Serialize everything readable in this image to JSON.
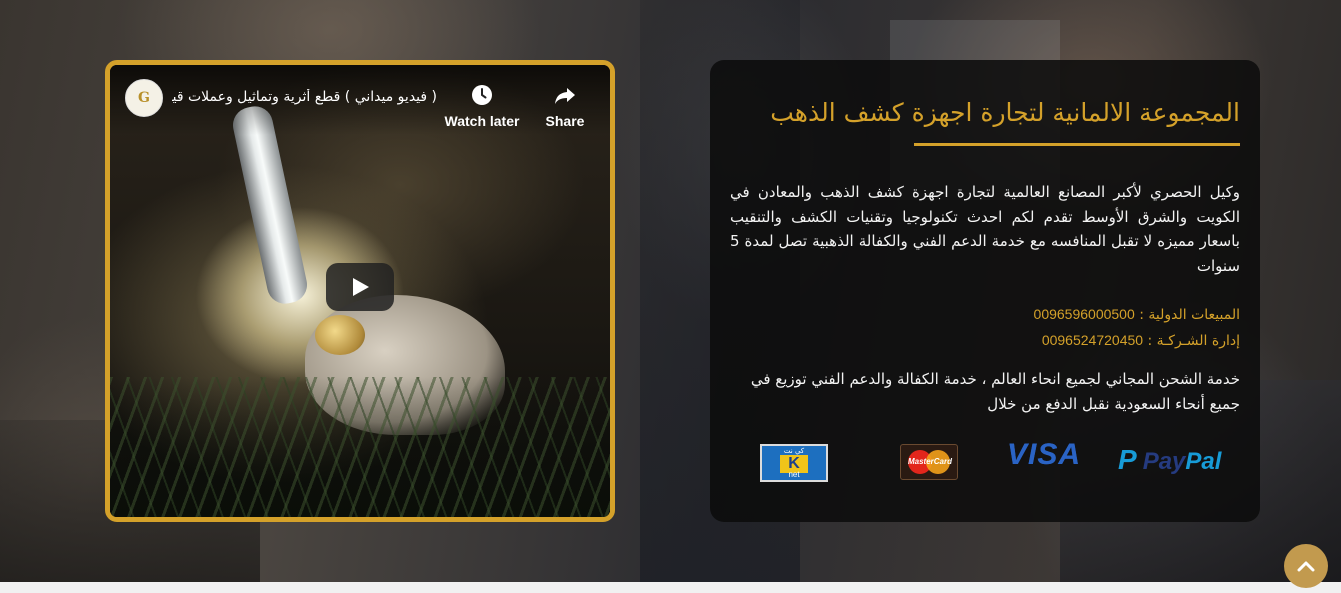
{
  "video": {
    "channel_logo_text": "G",
    "title": "( فيديو ميداني ) قطع أثرية وتماثيل وعملات قيمة...",
    "watch_later_label": "Watch later",
    "share_label": "Share"
  },
  "panel": {
    "title": "المجموعة الالمانية لتجارة اجهزة كشف الذهب",
    "description": "وكيل الحصري لأكبر المصانع العالمية لتجارة اجهزة كشف الذهب والمعادن في الكويت والشرق الأوسط تقدم لكم احدث تكنولوجيا وتقنيات الكشف والتنقيب باسعار مميزه لا تقبل المنافسه مع خدمة الدعم الفني والكفالة الذهبية تصل لمدة 5 سنوات",
    "sales_label": "المبيعات الدولية :",
    "sales_number": "0096596000500",
    "admin_label": "إدارة الشـركـة :",
    "admin_number": "0096524720450",
    "shipping": "خدمة الشحن المجاني لجميع انحاء العالم ، خدمة الكفالة والدعم الفني توزيع في جميع أنحاء السعودية نقبل الدفع من خلال"
  },
  "payments": {
    "paypal_pay": "Pay",
    "paypal_pal": "Pal",
    "visa": "VISA",
    "mastercard": "MasterCard",
    "knet_top": "كي نت",
    "knet_k": "K",
    "knet_bottom": "net"
  },
  "icons": {
    "scroll_top": "chevron-up-icon",
    "watch_later": "clock-icon",
    "share": "share-icon",
    "play": "play-icon"
  },
  "colors": {
    "accent_gold": "#d4a12a",
    "panel_bg": "#0c0c0c",
    "scroll_button": "#c29a4e"
  }
}
